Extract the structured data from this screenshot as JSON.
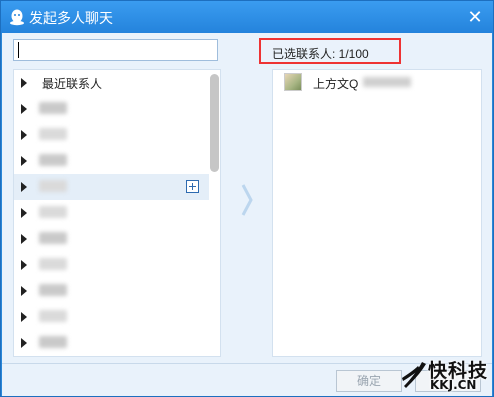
{
  "window": {
    "title": "发起多人聊天",
    "close_glyph": "✕"
  },
  "search": {
    "value": "",
    "placeholder": ""
  },
  "selected_header": {
    "text": "已选联系人: 1/100"
  },
  "contact_groups": [
    {
      "label": "最近联系人",
      "blurred": false
    },
    {
      "label": "",
      "blurred": true
    },
    {
      "label": "",
      "blurred": true
    },
    {
      "label": "",
      "blurred": true
    },
    {
      "label": "",
      "blurred": true,
      "highlighted": true
    },
    {
      "label": "",
      "blurred": true
    },
    {
      "label": "",
      "blurred": true
    },
    {
      "label": "",
      "blurred": true
    },
    {
      "label": "",
      "blurred": true
    },
    {
      "label": "",
      "blurred": true
    },
    {
      "label": "",
      "blurred": true
    }
  ],
  "selected_contacts": [
    {
      "name": "上方文Q"
    }
  ],
  "footer": {
    "ok_label": "确定"
  },
  "watermark": {
    "brand": "快科技",
    "domain": "KKJ.CN"
  },
  "icons": {
    "title": "qq-penguin-icon",
    "expand": "triangle-right-icon",
    "add": "plus-box-icon",
    "transfer": "chevron-right-icon"
  },
  "colors": {
    "titlebar": "#2483dc",
    "highlight_border": "#ee3333",
    "panel_bg": "#e9f2fb"
  }
}
